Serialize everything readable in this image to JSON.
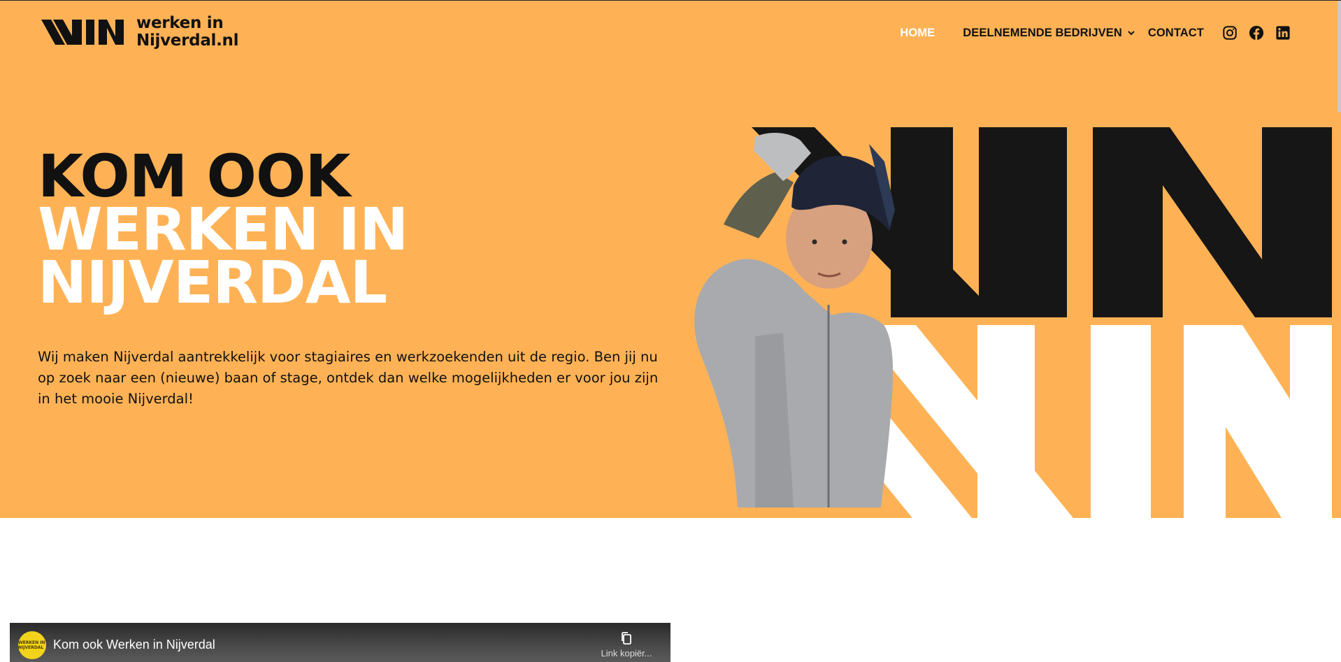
{
  "colors": {
    "hero_bg": "#ffb255",
    "dark": "#111111",
    "light": "#ffffff",
    "channel_badge": "#f2d31b"
  },
  "header": {
    "logo_mark": "WIN",
    "logo_line1": "werken in",
    "logo_line2": "Nijverdal.nl",
    "nav": {
      "home": "HOME",
      "bedrijven": "DEELNEMENDE BEDRIJVEN",
      "contact": "CONTACT"
    },
    "social_icons": [
      "instagram-icon",
      "facebook-icon",
      "linkedin-icon"
    ]
  },
  "hero": {
    "line1": "KOM OOK",
    "line2": "WERKEN IN",
    "line3": "NIJVERDAL",
    "intro": "Wij maken Nijverdal aantrekkelijk voor stagiaires en werkzoekenden uit de regio. Ben jij nu op zoek naar een (nieuwe) baan of stage, ontdek dan welke mogelijkheden er voor jou zijn in het mooie Nijverdal!"
  },
  "video": {
    "title": "Kom ook Werken in Nijverdal",
    "copy_label": "Link kopiër...",
    "channel_badge": "WERKEN IN NIJVERDAL"
  }
}
